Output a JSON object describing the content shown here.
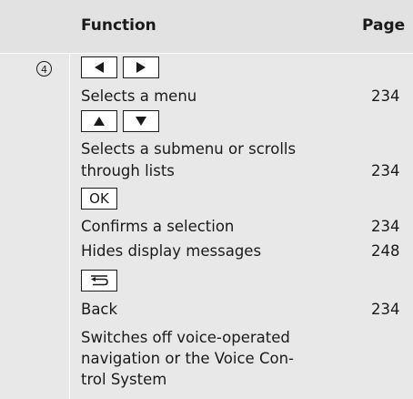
{
  "table": {
    "header": {
      "function": "Function",
      "page": "Page"
    },
    "marker": "4",
    "rows": [
      {
        "text": "Selects a menu",
        "page": "234"
      },
      {
        "line1": "Selects a submenu or scrolls",
        "line2": "through lists",
        "page": "234"
      },
      {
        "text": "Confirms a selection",
        "page": "234"
      },
      {
        "text": "Hides display messages",
        "page": "248"
      },
      {
        "text": "Back",
        "page": "234"
      },
      {
        "line1": "Switches off voice-operated",
        "line2": "navigation or the Voice Con-",
        "line3": "trol System"
      }
    ],
    "keys": {
      "left": "left-arrow-icon",
      "right": "right-arrow-icon",
      "up": "up-arrow-icon",
      "down": "down-arrow-icon",
      "ok": "OK",
      "back": "back-icon"
    }
  }
}
